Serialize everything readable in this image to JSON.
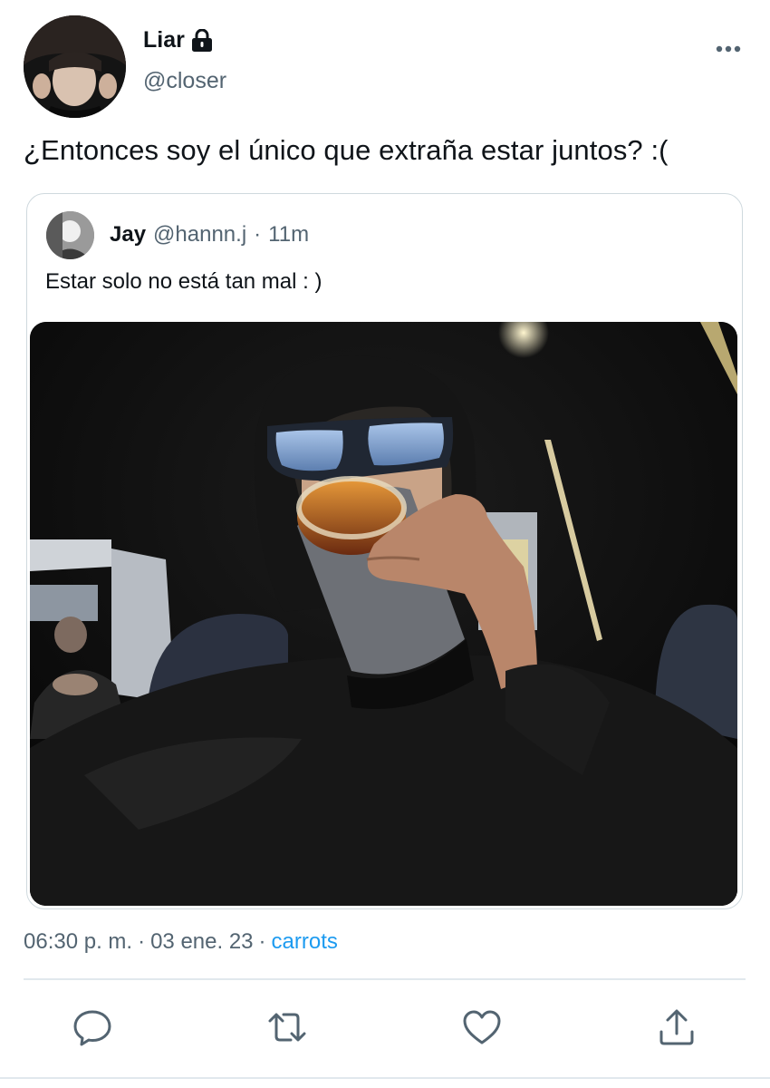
{
  "author": {
    "display_name": "Liar",
    "handle": "@closer",
    "protected_icon": "lock-icon"
  },
  "tweet": {
    "text": "¿Entonces soy el único que extraña estar juntos? :("
  },
  "quote": {
    "display_name": "Jay",
    "handle": "@hannn.j",
    "separator": "·",
    "time": "11m",
    "text": "Estar solo no está tan mal : )"
  },
  "meta": {
    "time": "06:30 p. m.",
    "sep1": "·",
    "date": "03 ene. 23",
    "sep2": "·",
    "source": "carrots"
  },
  "actions": [
    "reply-icon",
    "retweet-icon",
    "like-icon",
    "share-icon"
  ],
  "colors": {
    "text": "#0f1419",
    "secondary": "#536471",
    "link": "#1d9bf0",
    "border": "#cfd9de"
  }
}
